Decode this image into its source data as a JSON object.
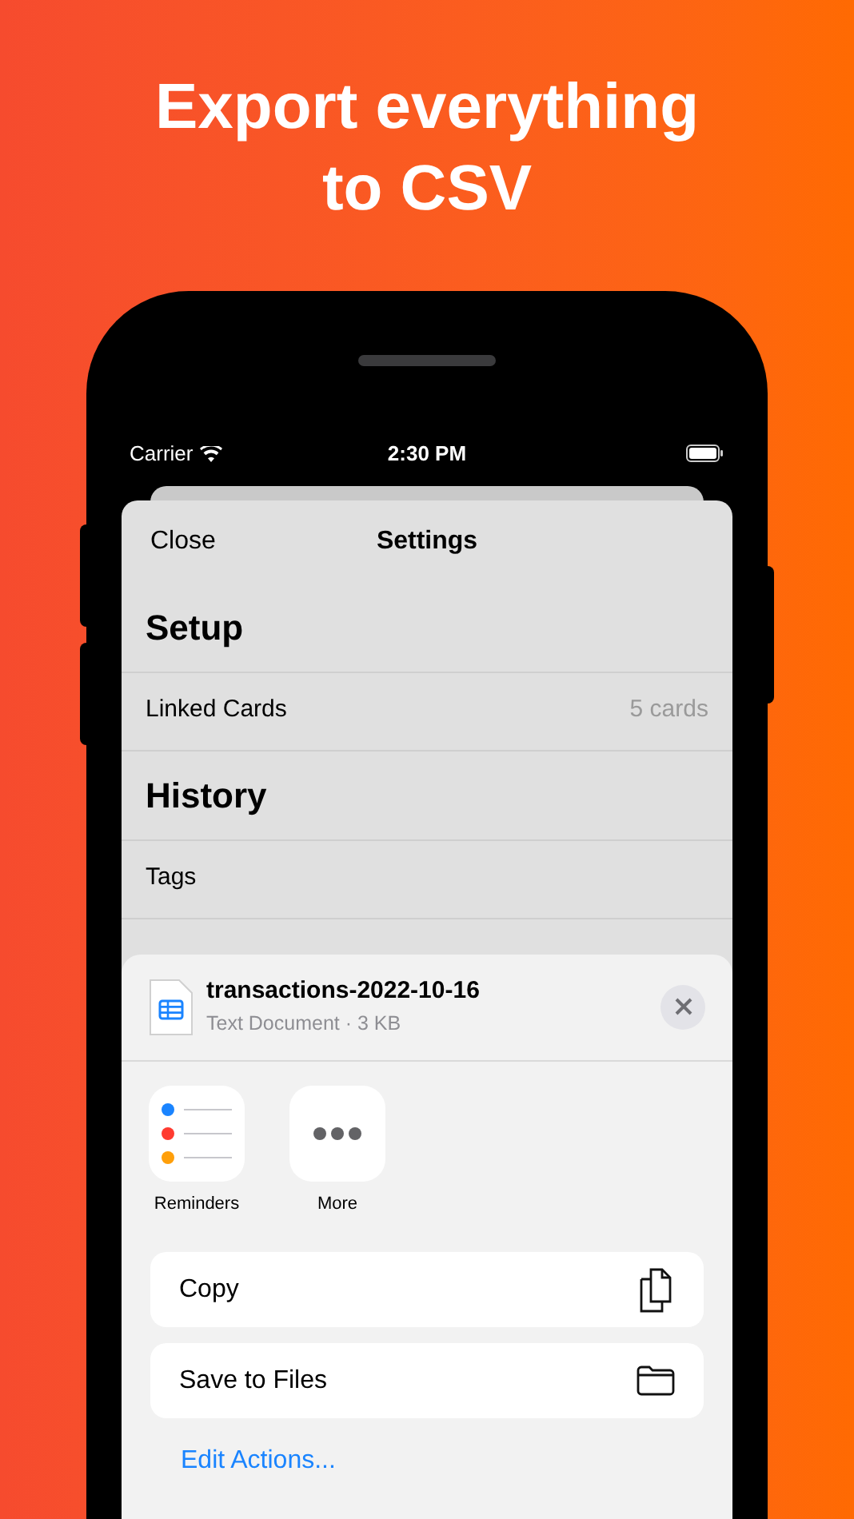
{
  "headline": "Export everything to CSV",
  "status_bar": {
    "carrier": "Carrier",
    "time": "2:30 PM"
  },
  "settings": {
    "close": "Close",
    "title": "Settings",
    "items": [
      {
        "kind": "header",
        "label": "Setup"
      },
      {
        "kind": "row",
        "label": "Linked Cards",
        "value": "5 cards"
      },
      {
        "kind": "header",
        "label": "History"
      },
      {
        "kind": "row",
        "label": "Tags"
      }
    ]
  },
  "share": {
    "file_name": "transactions-2022-10-16",
    "file_info": "Text Document · 3 KB",
    "apps": [
      {
        "kind": "reminders",
        "label": "Reminders"
      },
      {
        "kind": "more",
        "label": "More"
      }
    ],
    "actions": [
      {
        "kind": "copy",
        "label": "Copy"
      },
      {
        "kind": "folder",
        "label": "Save to Files"
      }
    ],
    "edit_link": "Edit Actions..."
  }
}
